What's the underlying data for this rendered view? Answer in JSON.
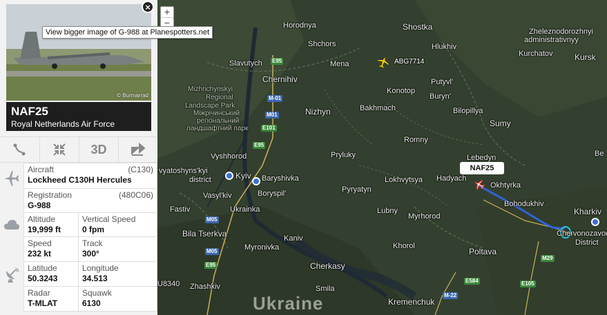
{
  "map": {
    "zoom_in": "+",
    "zoom_out": "−",
    "country": "Ukraine",
    "cities": [
      {
        "name": "Horodnya",
        "style": ""
      },
      {
        "name": "Shostka",
        "style": "big"
      },
      {
        "name": "Zheleznodorozhnyi",
        "style": ""
      },
      {
        "name": "administrativnyy",
        "style": ""
      },
      {
        "name": "Shchors",
        "style": ""
      },
      {
        "name": "Hlukhiv",
        "style": ""
      },
      {
        "name": "Kurchatov",
        "style": ""
      },
      {
        "name": "Slavutych",
        "style": ""
      },
      {
        "name": "Mena",
        "style": ""
      },
      {
        "name": "Kursk",
        "style": "big"
      },
      {
        "name": "Chernihiv",
        "style": "big"
      },
      {
        "name": "Putyvl'",
        "style": ""
      },
      {
        "name": "Konotop",
        "style": ""
      },
      {
        "name": "Buryn'",
        "style": ""
      },
      {
        "name": "Nizhyn",
        "style": "big"
      },
      {
        "name": "Bakhmach",
        "style": ""
      },
      {
        "name": "Bilopillya",
        "style": ""
      },
      {
        "name": "Sumy",
        "style": "big"
      },
      {
        "name": "Romny",
        "style": ""
      },
      {
        "name": "Vyshhorod",
        "style": ""
      },
      {
        "name": "Pryluky",
        "style": ""
      },
      {
        "name": "Lebedyn",
        "style": ""
      },
      {
        "name": "Kyiv",
        "style": "big"
      },
      {
        "name": "Baryshivka",
        "style": ""
      },
      {
        "name": "Vasyl'kiv",
        "style": ""
      },
      {
        "name": "Boryspil'",
        "style": ""
      },
      {
        "name": "Lokhvytsya",
        "style": ""
      },
      {
        "name": "Hadyach",
        "style": ""
      },
      {
        "name": "Okhtyrka",
        "style": ""
      },
      {
        "name": "Pyryatyn",
        "style": ""
      },
      {
        "name": "Bohodukhiv",
        "style": ""
      },
      {
        "name": "Fastiv",
        "style": ""
      },
      {
        "name": "Ukrainka",
        "style": ""
      },
      {
        "name": "Kharkiv",
        "style": "big"
      },
      {
        "name": "Bila Tserkva",
        "style": "big"
      },
      {
        "name": "Lubny",
        "style": ""
      },
      {
        "name": "Myrhorod",
        "style": ""
      },
      {
        "name": "Kaniv",
        "style": ""
      },
      {
        "name": "Myronivka",
        "style": ""
      },
      {
        "name": "Khorol",
        "style": ""
      },
      {
        "name": "Chervonozavods",
        "style": ""
      },
      {
        "name": "District",
        "style": ""
      },
      {
        "name": "Poltava",
        "style": "big"
      },
      {
        "name": "Cherkasy",
        "style": "big"
      },
      {
        "name": "Smila",
        "style": ""
      },
      {
        "name": "Zhashkiv",
        "style": ""
      },
      {
        "name": "Kremenchuk",
        "style": "big"
      },
      {
        "name": "vyatoshyns'kyi",
        "style": ""
      },
      {
        "name": "district",
        "style": ""
      },
      {
        "name": "Be",
        "style": ""
      }
    ],
    "park": [
      "Mizhrichynskyi",
      "Regional",
      "Landscape Park",
      "Міжрічинський",
      "регіональний",
      "ландшафтний парк"
    ],
    "roads": [
      "E95",
      "M-01",
      "M01",
      "E101",
      "E95",
      "M05",
      "M05",
      "E95",
      "M29",
      "E584",
      "M-22",
      "E105"
    ],
    "flights": [
      {
        "callsign": "ABG7714"
      },
      {
        "callsign": "NAF25"
      }
    ],
    "edge_label": "U8340"
  },
  "panel": {
    "photo_credit": "© Burmarrad",
    "tooltip": "View bigger image of G-988 at Planespotters.net",
    "close": "×",
    "callsign": "NAF25",
    "operator": "Royal Netherlands Air Force",
    "toolbar": {
      "view_3d": "3D"
    },
    "aircraft_label": "Aircraft",
    "aircraft_code": "(C130)",
    "aircraft_value": "Lockheed C130H Hercules",
    "registration_label": "Registration",
    "registration_code": "(480C06)",
    "registration_value": "G-988",
    "altitude_label": "Altitude",
    "altitude_value": "19,999 ft",
    "vspeed_label": "Vertical Speed",
    "vspeed_value": "0 fpm",
    "speed_label": "Speed",
    "speed_value": "232 kt",
    "track_label": "Track",
    "track_value": "300°",
    "latitude_label": "Latitude",
    "latitude_value": "50.3243",
    "longitude_label": "Longitude",
    "longitude_value": "34.513",
    "radar_label": "Radar",
    "radar_value": "T-MLAT",
    "squawk_label": "Squawk",
    "squawk_value": "6130"
  },
  "colors": {
    "route": "#2f63d6",
    "selected_plane": "#d9352a",
    "other_plane": "#f5d000"
  }
}
